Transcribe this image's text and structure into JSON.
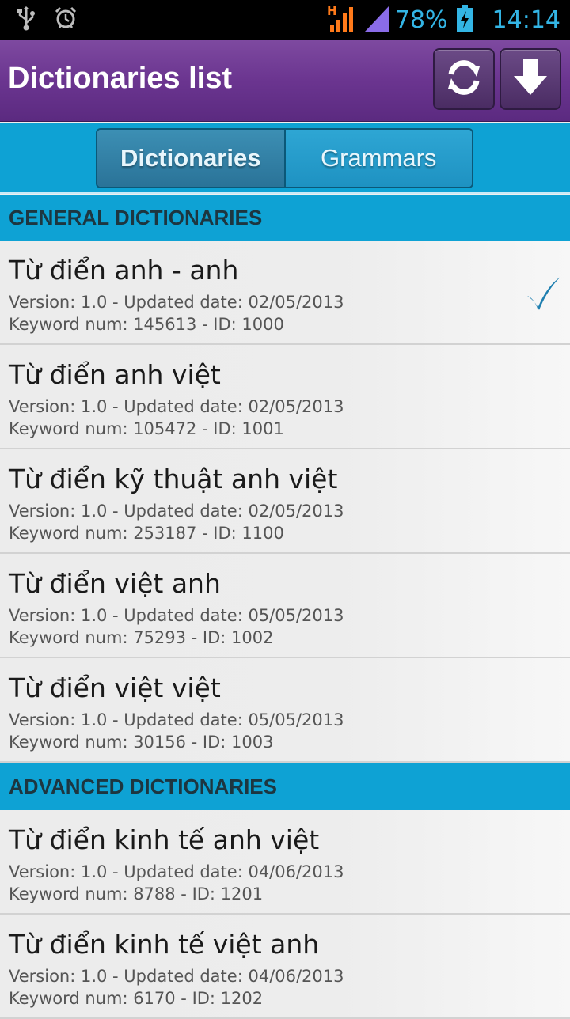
{
  "status_bar": {
    "battery_percent": "78%",
    "clock": "14:14",
    "network_type": "H",
    "icons": [
      "usb-icon",
      "alarm-icon",
      "signal-h-icon",
      "wifi-signal-icon",
      "battery-charging-icon"
    ]
  },
  "action_bar": {
    "title": "Dictionaries list",
    "buttons": [
      "sync-icon",
      "download-icon"
    ],
    "accent_color": "#6b3590"
  },
  "tabs": {
    "items": [
      {
        "label": "Dictionaries",
        "active": true
      },
      {
        "label": "Grammars",
        "active": false
      }
    ],
    "accent_color": "#0ea2d4"
  },
  "sections": [
    {
      "header": "GENERAL DICTIONARIES",
      "items": [
        {
          "title": "Từ điển anh - anh",
          "version_line": "Version: 1.0 - Updated date: 02/05/2013",
          "keyword_line": "Keyword num: 145613 - ID: 1000",
          "selected": true
        },
        {
          "title": "Từ điển anh việt",
          "version_line": "Version: 1.0 - Updated date: 02/05/2013",
          "keyword_line": "Keyword num: 105472 - ID: 1001",
          "selected": false
        },
        {
          "title": "Từ điển kỹ thuật anh việt",
          "version_line": "Version: 1.0 - Updated date: 02/05/2013",
          "keyword_line": "Keyword num: 253187 - ID: 1100",
          "selected": false
        },
        {
          "title": "Từ điển việt anh",
          "version_line": "Version: 1.0 - Updated date: 05/05/2013",
          "keyword_line": "Keyword num: 75293 - ID: 1002",
          "selected": false
        },
        {
          "title": "Từ điển việt việt",
          "version_line": "Version: 1.0 - Updated date: 05/05/2013",
          "keyword_line": "Keyword num: 30156 - ID: 1003",
          "selected": false
        }
      ]
    },
    {
      "header": "ADVANCED DICTIONARIES",
      "items": [
        {
          "title": "Từ điển kinh tế anh việt",
          "version_line": "Version: 1.0 - Updated date: 04/06/2013",
          "keyword_line": "Keyword num: 8788 - ID: 1201",
          "selected": false
        },
        {
          "title": "Từ điển kinh tế việt anh",
          "version_line": "Version: 1.0 - Updated date: 04/06/2013",
          "keyword_line": "Keyword num: 6170 - ID: 1202",
          "selected": false
        }
      ]
    }
  ],
  "check_icon": "checkmark-icon",
  "check_color": "#1e7fb0"
}
